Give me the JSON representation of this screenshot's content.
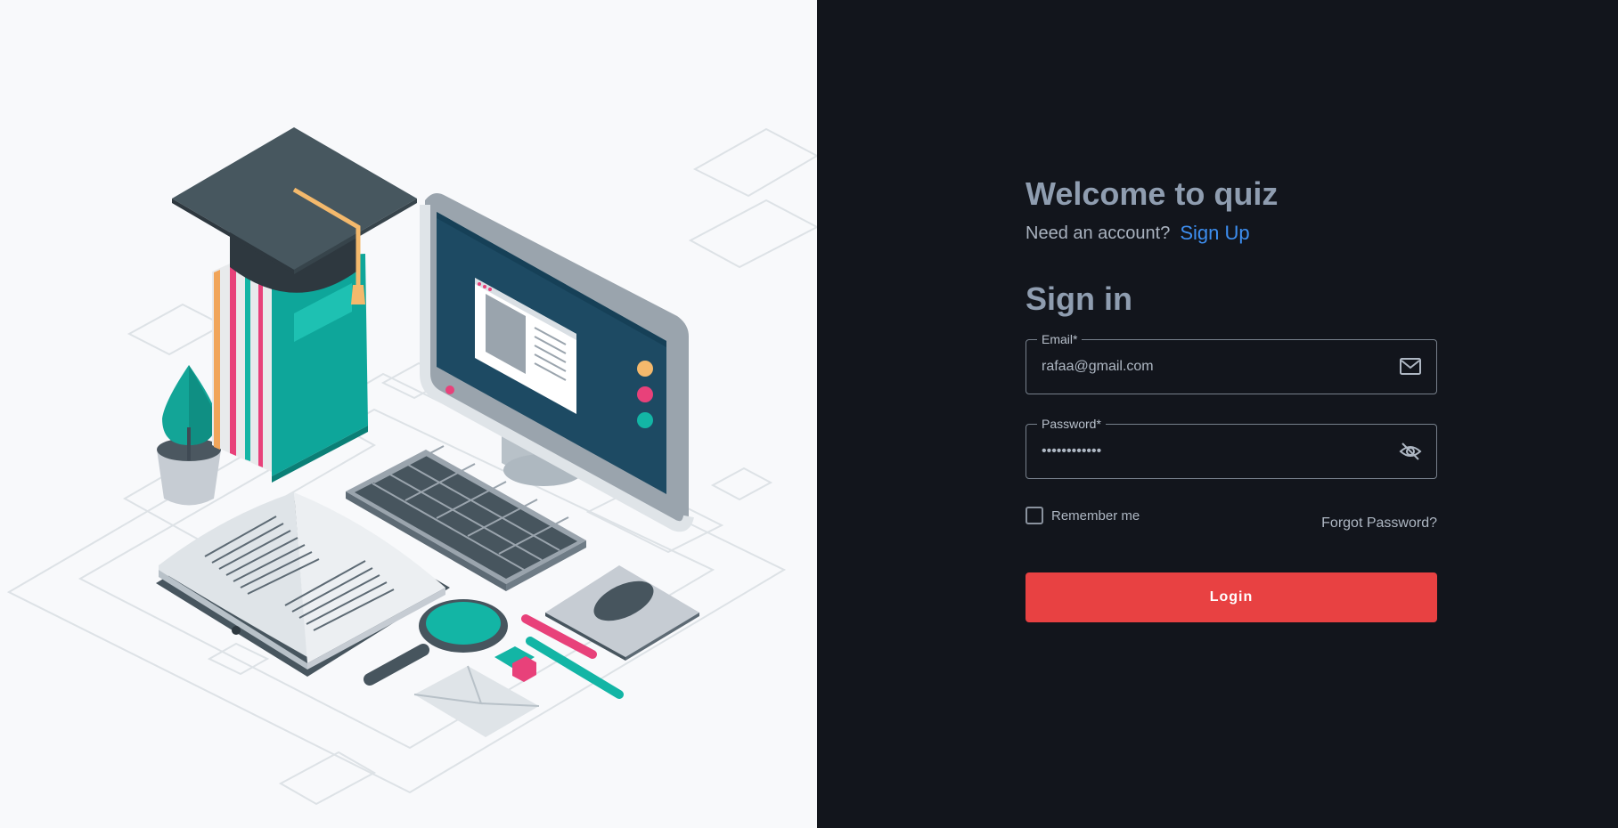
{
  "welcome": {
    "title": "Welcome to quiz",
    "account_question": "Need an account?",
    "signup_label": "Sign Up"
  },
  "signin": {
    "title": "Sign in"
  },
  "email": {
    "label": "Email*",
    "value": "rafaa@gmail.com",
    "icon": "mail-icon"
  },
  "password": {
    "label": "Password*",
    "value": "••••••••••••",
    "icon": "eye-off-icon"
  },
  "remember": {
    "label": "Remember me",
    "checked": false
  },
  "forgot": {
    "label": "Forgot Password?"
  },
  "login": {
    "label": "Login"
  },
  "colors": {
    "accent": "#e84142",
    "link": "#3d8ef0",
    "panel_bg": "#12151c",
    "illustration_bg": "#f8f9fb",
    "teal": "#13b5a5",
    "pink": "#e8417a"
  }
}
